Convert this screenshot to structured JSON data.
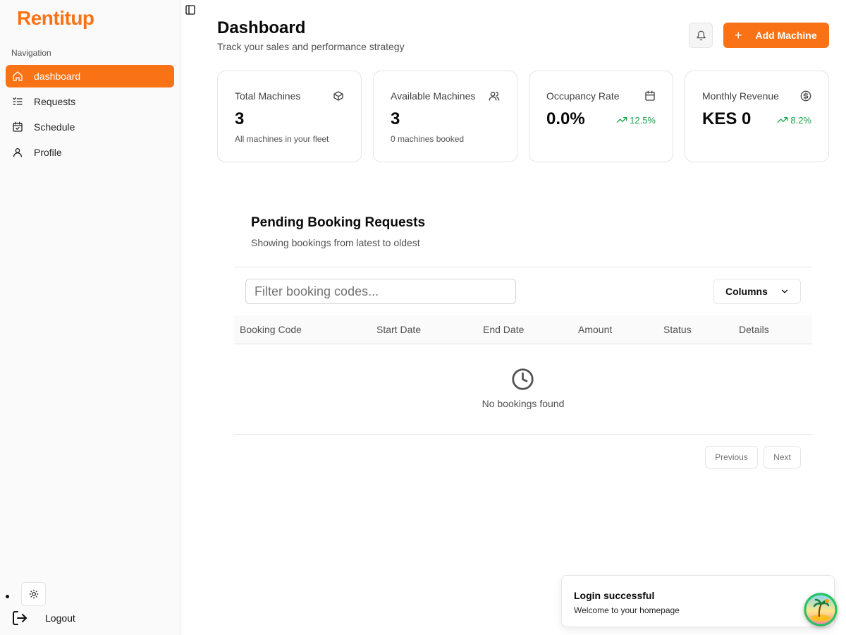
{
  "sidebar": {
    "brand": "Rentitup",
    "group_label": "Navigation",
    "items": [
      {
        "label": "dashboard",
        "icon": "home-icon",
        "active": true
      },
      {
        "label": "Requests",
        "icon": "list-check-icon",
        "active": false
      },
      {
        "label": "Schedule",
        "icon": "calendar-check-icon",
        "active": false
      },
      {
        "label": "Profile",
        "icon": "user-icon",
        "active": false
      }
    ],
    "theme_toggle_icon": "sun-icon",
    "logout_label": "Logout",
    "logout_icon": "logout-icon"
  },
  "header": {
    "title": "Dashboard",
    "subtitle": "Track your sales and performance strategy",
    "bell_icon": "bell-icon",
    "add_button_label": "Add Machine"
  },
  "stats": [
    {
      "label": "Total Machines",
      "value": "3",
      "sub": "All machines in your fleet",
      "icon": "box-icon"
    },
    {
      "label": "Available Machines",
      "value": "3",
      "sub": "0 machines booked",
      "icon": "users-icon"
    },
    {
      "label": "Occupancy Rate",
      "value": "0.0%",
      "trend": "12.5%",
      "icon": "calendar-icon"
    },
    {
      "label": "Monthly Revenue",
      "value": "KES 0",
      "trend": "8.2%",
      "icon": "dollar-circle-icon"
    }
  ],
  "pending": {
    "title": "Pending Booking Requests",
    "subtitle": "Showing bookings from latest to oldest",
    "filter_placeholder": "Filter booking codes...",
    "columns_label": "Columns",
    "table_headers": [
      "Booking Code",
      "Start Date",
      "End Date",
      "Amount",
      "Status",
      "Details"
    ],
    "empty_text": "No bookings found",
    "prev_label": "Previous",
    "next_label": "Next"
  },
  "toast": {
    "title": "Login successful",
    "message": "Welcome to your homepage"
  },
  "colors": {
    "accent": "#f97316",
    "trend_up": "#16a34a"
  }
}
